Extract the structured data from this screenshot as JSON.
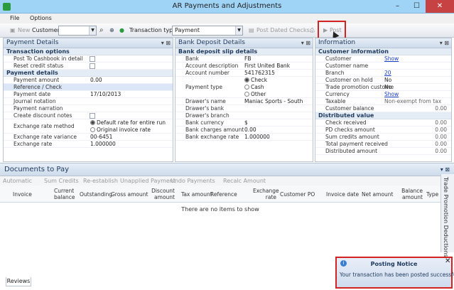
{
  "window": {
    "title": "AR Payments and Adjustments",
    "min": "–",
    "max": "☐",
    "close": "✕"
  },
  "menu": [
    "File",
    "Options"
  ],
  "toolbar": {
    "new": "New",
    "customer_label": "Customer:",
    "customer_value": "",
    "transaction_type_label": "Transaction type:",
    "transaction_type_value": "Payment",
    "post_dated": "Post Dated Checks...",
    "post": "Post"
  },
  "payment_details": {
    "title": "Payment Details",
    "sections": [
      {
        "name": "Transaction options",
        "rows": [
          {
            "label": "Post To Cashbook in detail",
            "type": "checkbox",
            "checked": false
          },
          {
            "label": "Reset credit status",
            "type": "checkbox",
            "checked": false
          }
        ]
      },
      {
        "name": "Payment details",
        "rows": [
          {
            "label": "Payment amount",
            "value": "0.00"
          },
          {
            "label": "Reference / Check",
            "value": ""
          },
          {
            "label": "Payment date",
            "value": "17/10/2013"
          },
          {
            "label": "Journal notation",
            "value": ""
          },
          {
            "label": "Payment narration",
            "value": ""
          },
          {
            "label": "Create discount notes",
            "type": "checkbox",
            "checked": false
          },
          {
            "label": "Exchange rate method",
            "type": "radio",
            "options": [
              "Default rate for entire run",
              "Original invoice rate"
            ]
          },
          {
            "label": "Exchange rate variance",
            "value": "00-6451"
          },
          {
            "label": "Exchange rate",
            "value": "1.000000"
          }
        ]
      }
    ]
  },
  "bank_details": {
    "title": "Bank Deposit Details",
    "section": "Bank deposit slip details",
    "rows": [
      {
        "label": "Bank",
        "value": "FB"
      },
      {
        "label": "Account description",
        "value": "First United Bank"
      },
      {
        "label": "Account number",
        "value": "541762315"
      },
      {
        "label": "Payment type",
        "options": [
          "Check",
          "Cash",
          "Other"
        ]
      },
      {
        "label": "Drawer's name",
        "value": "Maniac Sports - South"
      },
      {
        "label": "Drawer's bank",
        "value": ""
      },
      {
        "label": "Drawer's branch",
        "value": ""
      },
      {
        "label": "Bank currency",
        "value": "$"
      },
      {
        "label": "Bank charges amount",
        "value": "0.00"
      },
      {
        "label": "Bank exchange rate",
        "value": "1.000000"
      }
    ]
  },
  "information": {
    "title": "Information",
    "section1": "Customer information",
    "rows1": [
      {
        "label": "Customer",
        "value": "Show",
        "link": true
      },
      {
        "label": "Customer name",
        "value": ""
      },
      {
        "label": "Branch",
        "value": "20",
        "link": true
      },
      {
        "label": "Customer on hold",
        "value": "No"
      },
      {
        "label": "Trade promotion custome",
        "value": "No"
      },
      {
        "label": "Currency",
        "value": "Show",
        "link": true
      },
      {
        "label": "Taxable",
        "value": "Non-exempt from tax"
      },
      {
        "label": "Customer balance",
        "value": "0.00"
      }
    ],
    "section2": "Distributed value",
    "rows2": [
      {
        "label": "Check received",
        "value": "0.00"
      },
      {
        "label": "PD checks amount",
        "value": "0.00"
      },
      {
        "label": "Sum credits amount",
        "value": "0.00"
      },
      {
        "label": "Total payment received",
        "value": "0.00"
      },
      {
        "label": "Distributed amount",
        "value": "0.00"
      }
    ]
  },
  "documents": {
    "title": "Documents to Pay",
    "toolbar": [
      "Automatic",
      "Sum Credits",
      "Re-establish",
      "Unapplied Payment",
      "Undo Payments",
      "Recalc Amount"
    ],
    "columns": [
      "Invoice",
      "Current balance",
      "Outstanding",
      "Gross amount",
      "Discount amount",
      "Tax amount",
      "Reference",
      "Exchange rate",
      "Customer PO",
      "Invoice date",
      "Net amount",
      "Balance amount",
      "Type"
    ],
    "empty": "There are no items to show",
    "side_tab": "Trade Promotion Deductions",
    "bottom_tab": "Reviews"
  },
  "notice": {
    "title": "Posting Notice",
    "message": "Your transaction has been posted successfully."
  }
}
